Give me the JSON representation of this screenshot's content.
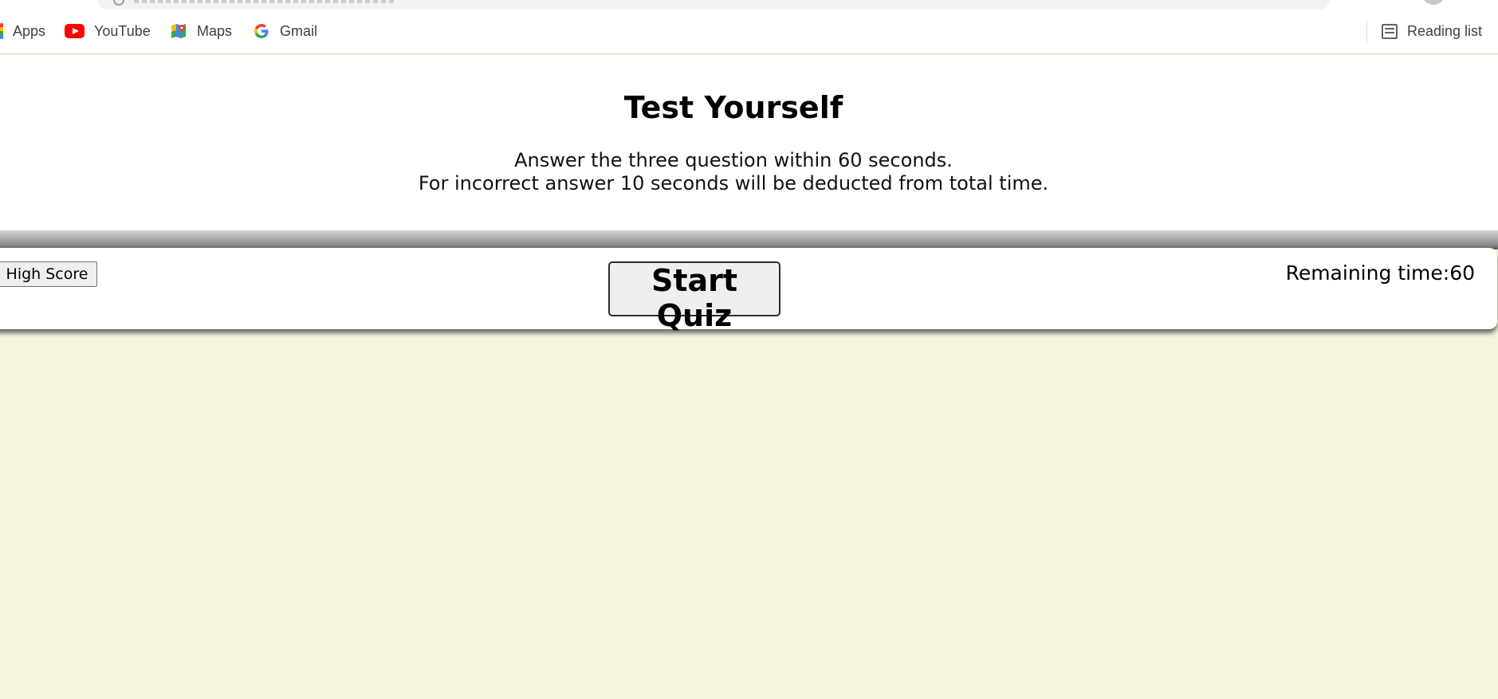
{
  "browser": {
    "bookmarks": [
      {
        "label": "Apps",
        "icon": "apps-icon"
      },
      {
        "label": "YouTube",
        "icon": "youtube-icon"
      },
      {
        "label": "Maps",
        "icon": "maps-icon"
      },
      {
        "label": "Gmail",
        "icon": "google-icon"
      }
    ],
    "reading_list": {
      "label": "Reading list",
      "icon": "reading-list-icon"
    }
  },
  "page": {
    "title": "Test Yourself",
    "description_line1": "Answer the three question within 60 seconds.",
    "description_line2": "For incorrect answer 10 seconds will be deducted from total time."
  },
  "controls": {
    "high_score_label": "High Score",
    "start_label": "Start Quiz",
    "timer_label": "Remaining time:",
    "timer_value": "60"
  },
  "colors": {
    "background": "#f5f5dc",
    "panel": "#ffffff"
  }
}
